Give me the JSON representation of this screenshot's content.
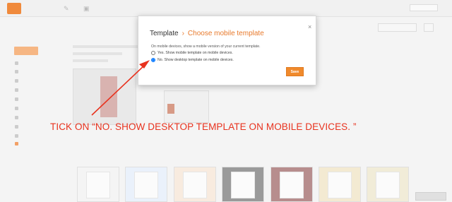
{
  "dialog": {
    "breadcrumb_root": "Template",
    "breadcrumb_separator": "›",
    "title": "Choose mobile template",
    "close_glyph": "×",
    "description": "On mobile devices, show a mobile version of your current template.",
    "options": [
      {
        "label": "Yes. Show mobile template on mobile devices.",
        "selected": false
      },
      {
        "label": "No. Show desktop template on mobile devices.",
        "selected": true
      }
    ],
    "save_label": "Save"
  },
  "annotation": {
    "text": "TICK ON “NO. SHOW DESKTOP TEMPLATE ON MOBILE DEVICES. ”",
    "color": "#e8321e"
  },
  "background": {
    "accent_color": "#f08a3c",
    "icons": [
      "logo-icon",
      "pencil-icon",
      "copy-icon"
    ]
  }
}
